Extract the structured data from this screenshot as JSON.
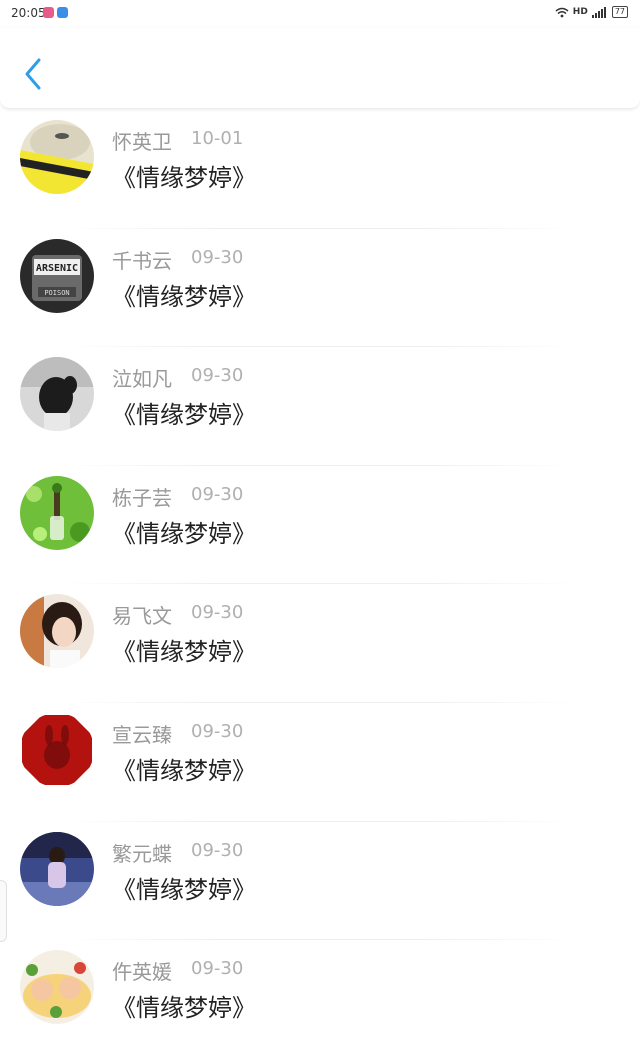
{
  "status_bar": {
    "time": "20:05",
    "network_label": "HD",
    "battery": "77"
  },
  "nav": {
    "back_icon": "chevron-left-icon",
    "accent_color": "#2f9ee6"
  },
  "items": [
    {
      "name": "怀英卫",
      "date": "10-01",
      "title": "《情缘梦婷》"
    },
    {
      "name": "千书云",
      "date": "09-30",
      "title": "《情缘梦婷》",
      "avatar_text_top": "ARSENIC",
      "avatar_text_bottom": "POISON"
    },
    {
      "name": "泣如凡",
      "date": "09-30",
      "title": "《情缘梦婷》"
    },
    {
      "name": "栋子芸",
      "date": "09-30",
      "title": "《情缘梦婷》"
    },
    {
      "name": "易飞文",
      "date": "09-30",
      "title": "《情缘梦婷》"
    },
    {
      "name": "宣云臻",
      "date": "09-30",
      "title": "《情缘梦婷》"
    },
    {
      "name": "繁元蝶",
      "date": "09-30",
      "title": "《情缘梦婷》"
    },
    {
      "name": "仵英媛",
      "date": "09-30",
      "title": "《情缘梦婷》"
    }
  ]
}
